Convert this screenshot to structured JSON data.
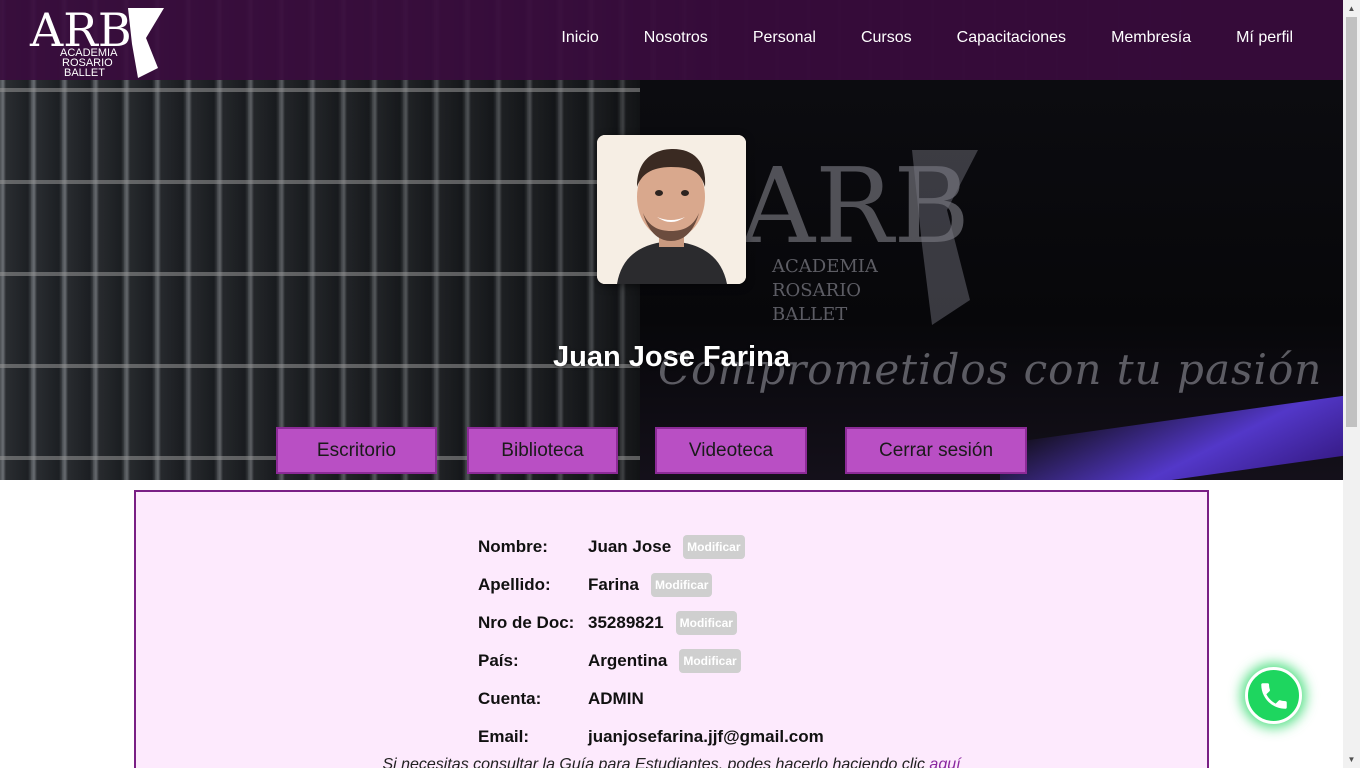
{
  "brand": {
    "logo_letters": "ARB",
    "logo_lines": [
      "ACADEMIA",
      "ROSARIO",
      "BALLET"
    ]
  },
  "nav": {
    "items": [
      {
        "label": "Inicio"
      },
      {
        "label": "Nosotros"
      },
      {
        "label": "Personal"
      },
      {
        "label": "Cursos"
      },
      {
        "label": "Capacitaciones"
      },
      {
        "label": "Membresía"
      },
      {
        "label": "Mí perfil"
      }
    ]
  },
  "hero": {
    "slogan": "Comprometidos con tu pasión",
    "bg_logo_letters": "ARB",
    "bg_logo_lines": [
      "ACADEMIA",
      "ROSARIO",
      "BALLET"
    ]
  },
  "profile": {
    "name": "Juan Jose Farina"
  },
  "actions": {
    "escritorio": "Escritorio",
    "biblioteca": "Biblioteca",
    "videoteca": "Videoteca",
    "cerrar_sesion": "Cerrar sesión"
  },
  "info": {
    "modify_label": "Modificar",
    "rows": [
      {
        "label": "Nombre:",
        "value": "Juan Jose"
      },
      {
        "label": "Apellido:",
        "value": "Farina"
      },
      {
        "label": "Nro de Doc:",
        "value": "35289821"
      },
      {
        "label": "País:",
        "value": "Argentina"
      },
      {
        "label": "Cuenta:",
        "value": "ADMIN"
      },
      {
        "label": "Email:",
        "value": "juanjosefarina.jjf@gmail.com"
      }
    ]
  },
  "guide": {
    "text": "Si necesitas consultar la Guía para Estudiantes, podes hacerlo haciendo clic ",
    "link": "aquí"
  },
  "colors": {
    "navbar": "#3a0c3e",
    "accent": "#b94fc4",
    "card_bg": "#fdeafd",
    "card_border": "#7a1f85",
    "whatsapp": "#1ed65f"
  },
  "icons": {
    "whatsapp": "whatsapp-phone-icon"
  }
}
